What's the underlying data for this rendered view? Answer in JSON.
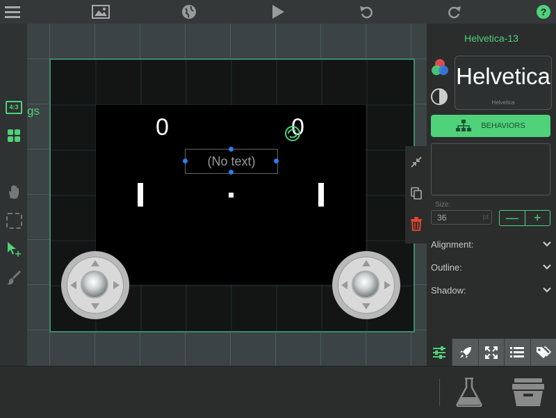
{
  "toolbar": {
    "icons": [
      "menu-icon",
      "image-icon",
      "globe-icon",
      "play-icon",
      "undo-icon",
      "redo-icon",
      "help-icon"
    ],
    "help_label": "?"
  },
  "leftbar": {
    "aspect_label": "4:3",
    "icons": [
      "aspect-ratio-icon",
      "grid-icon",
      "hand-icon",
      "marquee-select-icon",
      "pointer-move-icon",
      "paint-brush-icon"
    ]
  },
  "canvas": {
    "partial_label": "gs",
    "score_left": "0",
    "score_right": "0",
    "selected_text": "(No text)"
  },
  "panel": {
    "font_name": "Helvetica-13",
    "font_preview_large": "Helvetica",
    "font_preview_small": "Helvetica",
    "behaviors_label": "BEHAVIORS",
    "size_label": "Size:",
    "size_value": "36",
    "size_unit": "pt",
    "stepper_minus": "—",
    "stepper_plus": "+",
    "rows": [
      {
        "label": "Alignment:"
      },
      {
        "label": "Outline:"
      },
      {
        "label": "Shadow:"
      }
    ],
    "tabs": [
      "sliders-icon",
      "rocket-icon",
      "expand-icon",
      "list-icon",
      "tags-icon"
    ]
  },
  "colors": {
    "accent": "#4fd27a",
    "background": "#2b2d2d",
    "delete": "#e0462f",
    "handle": "#2f7cf2"
  }
}
